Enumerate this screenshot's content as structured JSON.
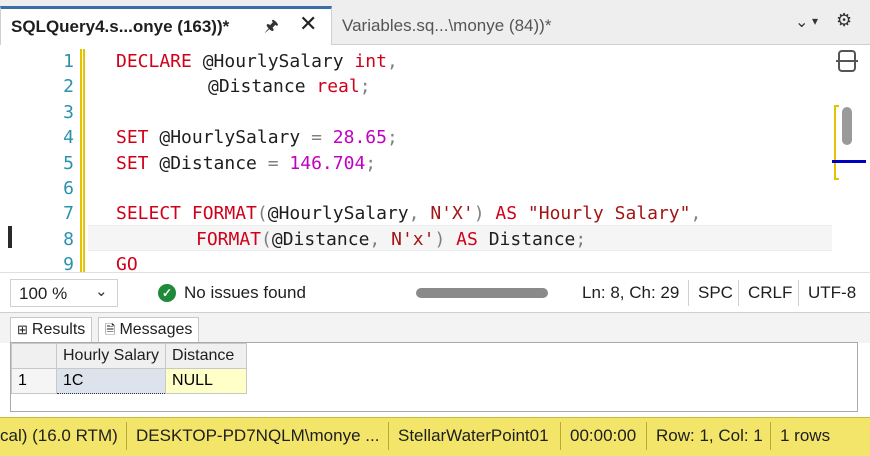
{
  "tabs": {
    "active_title": "SQLQuery4.s...onye (163))*",
    "inactive_title": "Variables.sq...\\monye (84))*"
  },
  "editor": {
    "line_numbers": [
      "1",
      "2",
      "3",
      "4",
      "5",
      "6",
      "7",
      "8",
      "9"
    ],
    "code": {
      "l1": {
        "kw": "DECLARE",
        "var": " @HourlySalary ",
        "type": "int",
        "punct": ","
      },
      "l2": {
        "var": "@Distance ",
        "type": "real",
        "punct": ";"
      },
      "l4": {
        "kw": "SET",
        "var": " @HourlySalary ",
        "op": "=",
        "num": "28.65",
        "punct": ";"
      },
      "l5": {
        "kw": "SET",
        "var": " @Distance ",
        "op": "=",
        "num": "146.704",
        "punct": ";"
      },
      "l7": {
        "kw": "SELECT",
        "fn": "FORMAT",
        "open": "(",
        "var": "@HourlySalary",
        "comma": ",",
        "str": "N'X'",
        "close": ")",
        "as": "AS",
        "alias": "\"Hourly Salary\"",
        "punct": ","
      },
      "l8": {
        "fn": "FORMAT",
        "open": "(",
        "var": "@Distance",
        "comma": ",",
        "str": "N'x'",
        "close": ")",
        "as": "AS",
        "alias": "Distance",
        "punct": ";"
      },
      "l9": {
        "kw": "GO"
      }
    }
  },
  "editor_status": {
    "zoom": "100 %",
    "issues": "No issues found",
    "position": "Ln: 8, Ch: 29",
    "whitespace": "SPC",
    "line_ending": "CRLF",
    "encoding": "UTF-8"
  },
  "results": {
    "tabs": [
      "Results",
      "Messages"
    ],
    "columns": [
      "Hourly Salary",
      "Distance"
    ],
    "rows": [
      {
        "num": "1",
        "hourly_salary": "1C",
        "distance": "NULL"
      }
    ]
  },
  "app_status": {
    "server_version": "cal) (16.0 RTM)",
    "user": "DESKTOP-PD7NQLM\\monye ...",
    "database": "StellarWaterPoint01",
    "elapsed": "00:00:00",
    "position": "Row: 1, Col: 1",
    "rows": "1 rows"
  },
  "colors": {
    "keyword": "#d1001a",
    "number": "#c200c2",
    "string": "#a31515",
    "line_number": "#2b91af",
    "status_bar": "#f2e56a"
  },
  "icons": [
    "pin-icon",
    "close-icon",
    "chevron-down-icon",
    "gear-icon",
    "check-circle-icon",
    "grid-icon",
    "messages-icon",
    "split-editor-icon"
  ]
}
